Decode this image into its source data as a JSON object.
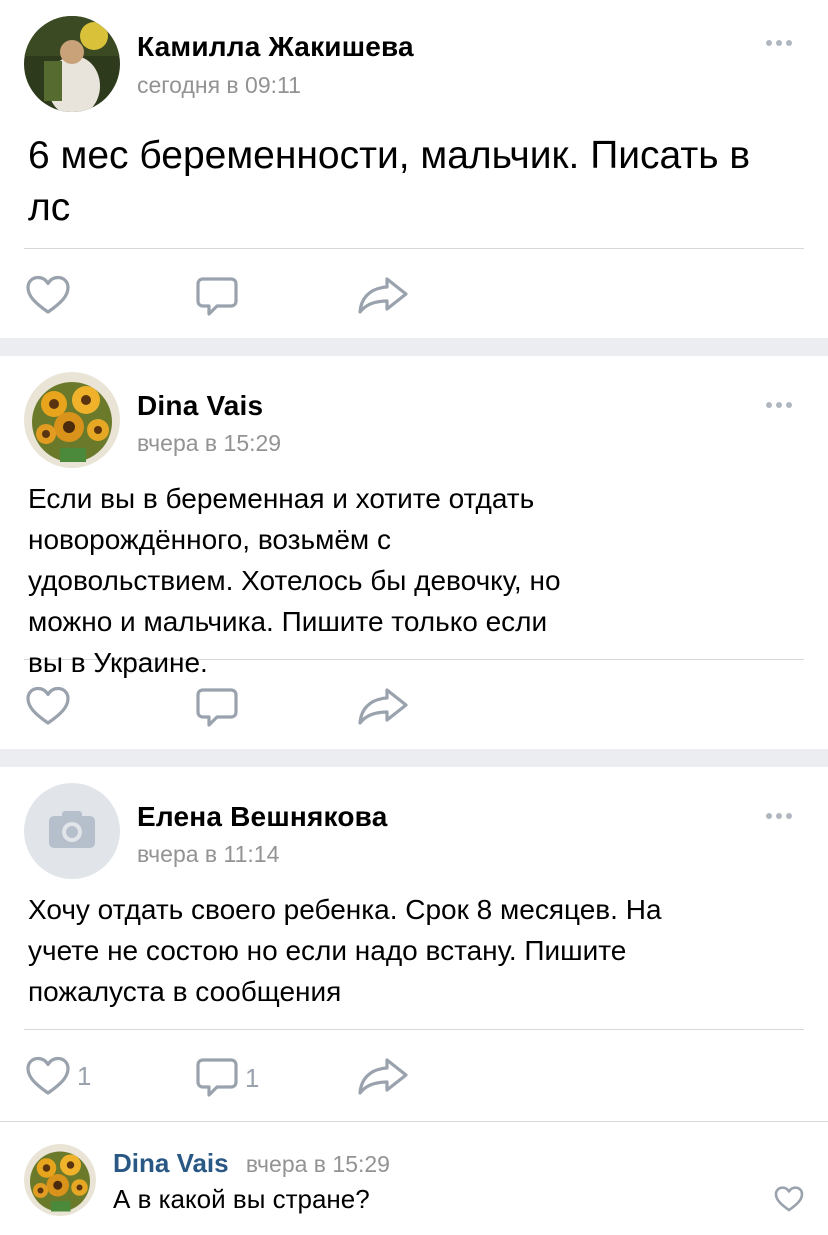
{
  "posts": [
    {
      "author": "Камилла Жакишева",
      "time": "сегодня в 09:11",
      "text": "6 мес беременности, мальчик. Писать в лс",
      "likes": "",
      "comments": ""
    },
    {
      "author": "Dina Vais",
      "time": "вчера в 15:29",
      "text": "Если вы в беременная и хотите отдать новорождённого, возьмём с удовольствием. Хотелось бы девочку, но можно и мальчика. Пишите только если вы в Украине.",
      "likes": "",
      "comments": ""
    },
    {
      "author": "Елена Вешнякова",
      "time": "вчера в 11:14",
      "text": "Хочу отдать своего ребенка. Срок 8 месяцев. На учете не состою но если надо встану. Пишите пожалуста в сообщения",
      "likes": "1",
      "comments": "1"
    }
  ],
  "comment": {
    "author": "Dina Vais",
    "time": "вчера в 15:29",
    "text": "А в какой вы стране?"
  },
  "colors": {
    "separator": "#ebedf0",
    "icon": "#99a2ad",
    "link": "#2a5885"
  }
}
